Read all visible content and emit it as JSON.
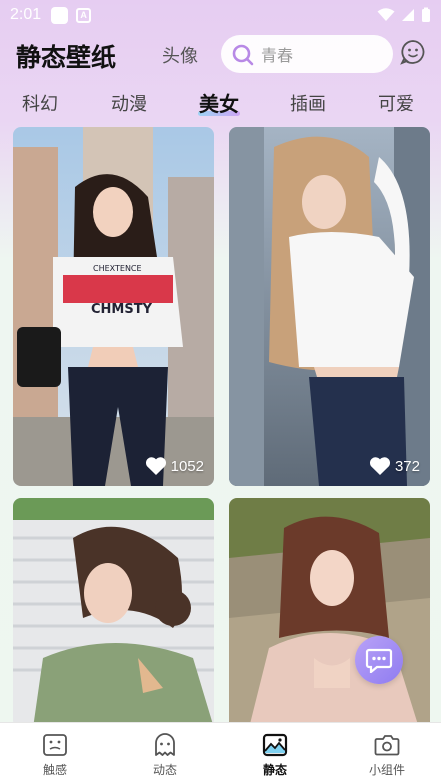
{
  "status_bar": {
    "time": "2:01"
  },
  "header": {
    "title": "静态壁纸",
    "avatar_link": "头像",
    "search_placeholder": "青春"
  },
  "tabs": [
    {
      "label": "科幻",
      "active": false
    },
    {
      "label": "动漫",
      "active": false
    },
    {
      "label": "美女",
      "active": true
    },
    {
      "label": "插画",
      "active": false
    },
    {
      "label": "可爱",
      "active": false
    }
  ],
  "cards": [
    {
      "likes": "1052"
    },
    {
      "likes": "372"
    },
    {
      "likes": ""
    },
    {
      "likes": ""
    }
  ],
  "card_text": {
    "shirt_top": "CHEXTENCE",
    "shirt_main": "CHMSTY"
  },
  "bottom_nav": [
    {
      "label": "触感",
      "icon": "image-frame-icon",
      "active": false
    },
    {
      "label": "动态",
      "icon": "ghost-icon",
      "active": false
    },
    {
      "label": "静态",
      "icon": "landscape-icon",
      "active": true
    },
    {
      "label": "小组件",
      "icon": "widget-camera-icon",
      "active": false
    }
  ],
  "colors": {
    "accent": "#9b7cf0",
    "tab_underline": "#8fd3f4"
  }
}
